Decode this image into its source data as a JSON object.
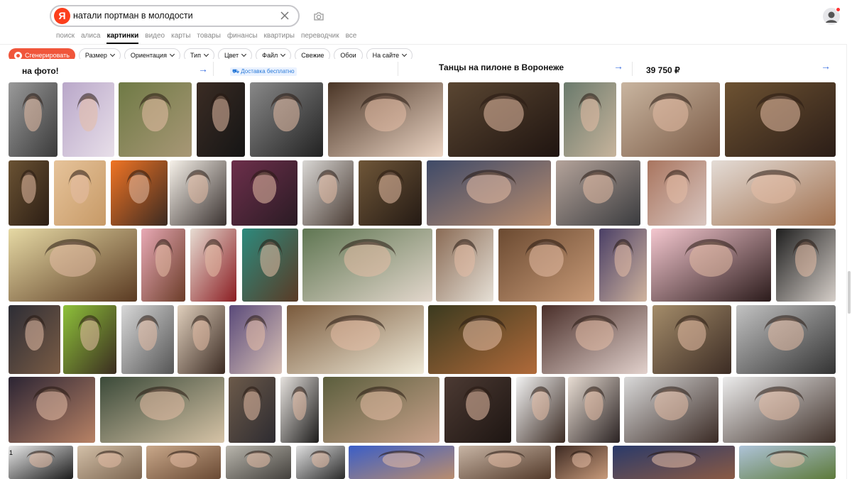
{
  "search": {
    "logo": "Я",
    "query": "натали портман в молодости"
  },
  "tabs": [
    "поиск",
    "алиса",
    "картинки",
    "видео",
    "карты",
    "товары",
    "финансы",
    "квартиры",
    "переводчик",
    "все"
  ],
  "active_tab": 2,
  "filters": {
    "generate_label": "Сгенерировать",
    "chips": [
      {
        "label": "Размер",
        "dropdown": true
      },
      {
        "label": "Ориентация",
        "dropdown": true
      },
      {
        "label": "Тип",
        "dropdown": true
      },
      {
        "label": "Цвет",
        "dropdown": true
      },
      {
        "label": "Файл",
        "dropdown": true
      },
      {
        "label": "Свежие",
        "dropdown": false
      },
      {
        "label": "Обои",
        "dropdown": false
      },
      {
        "label": "На сайте",
        "dropdown": true
      }
    ]
  },
  "ads": {
    "ad1_text": "на фото!",
    "ad2_badge": "Доставка бесплатно",
    "ad3_text": "Танцы на пилоне в Воронеже",
    "ad4_price": "39 750 ₽"
  },
  "page_number": "1",
  "colors": {
    "accent": "#fc3f1d",
    "generate": "#f0563b",
    "link": "#3b6fe0"
  }
}
